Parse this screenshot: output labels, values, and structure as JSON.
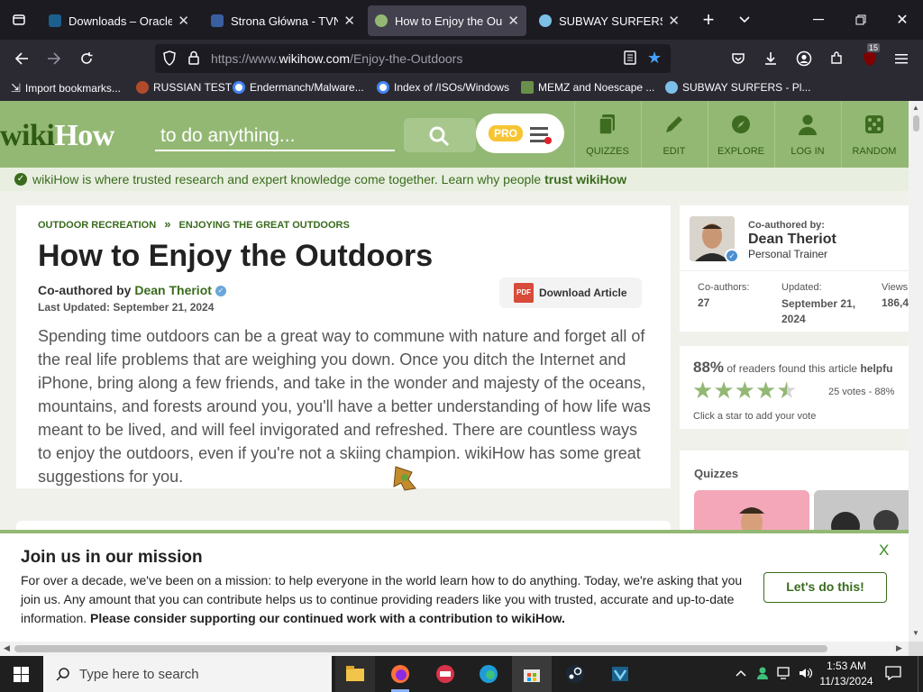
{
  "colors": {
    "brand_green": "#93b874",
    "dark_green": "#3a6b1d",
    "link_green": "#2e7d32"
  },
  "browser": {
    "tabs": [
      {
        "title": "Downloads – Oracle VirtualBox",
        "icon": "virtualbox-icon"
      },
      {
        "title": "Strona Główna - TVN",
        "icon": "tvn-icon"
      },
      {
        "title": "How to Enjoy the Outdoors",
        "icon": "wikihow-icon",
        "active": true
      },
      {
        "title": "SUBWAY SURFERS - Play",
        "icon": "game-icon"
      }
    ],
    "url_prefix": "https://www.",
    "url_domain": "wikihow.com",
    "url_path": "/Enjoy-the-Outdoors",
    "badge": "15",
    "bookmarks": [
      "Import bookmarks...",
      "RUSSIAN TEST",
      "Endermanch/Malware...",
      "Index of /ISOs/Windows",
      "MEMZ and Noescape ...",
      "SUBWAY SURFERS - Pl..."
    ]
  },
  "site": {
    "logo_wiki": "wiki",
    "logo_how": "How",
    "search_placeholder": "to do anything...",
    "pro": "PRO",
    "nav": [
      "QUIZZES",
      "EDIT",
      "EXPLORE",
      "LOG IN",
      "RANDOM"
    ],
    "trust_text": "wikiHow is where trusted research and expert knowledge come together. Learn why people ",
    "trust_link": "trust wikiHow"
  },
  "article": {
    "breadcrumb": [
      "OUTDOOR RECREATION",
      "ENJOYING THE GREAT OUTDOORS"
    ],
    "breadcrumb_sep": "»",
    "title": "How to Enjoy the Outdoors",
    "coauthor_label": "Co-authored by ",
    "coauthor": "Dean Theriot",
    "updated": "Last Updated: September 21, 2024",
    "download": "Download Article",
    "pdf": "PDF",
    "intro": "Spending time outdoors can be a great way to commune with nature and forget all of the real life problems that are weighing you down. Once you ditch the Internet and iPhone, bring along a few friends, and take in the wonder and majesty of the oceans, mountains, and forests around you, you'll have a better understanding of how life was meant to be lived, and will feel invigorated and refreshed. There are countless ways to enjoy the outdoors, even if you're not a skiing champion. wikiHow has some great suggestions for you."
  },
  "sidebar": {
    "coauthored_label": "Co-authored by:",
    "name": "Dean Theriot",
    "role": "Personal Trainer",
    "stats": [
      {
        "label": "Co-authors:",
        "value": "27"
      },
      {
        "label": "Updated:",
        "value": "September 21, 2024"
      },
      {
        "label": "Views",
        "value": "186,4"
      }
    ],
    "helpful_percent": "88%",
    "helpful_text": " of readers found this article ",
    "helpful_bold": "helpfu",
    "rating": 4.5,
    "votes": "25 votes - 88%",
    "rate_hint": "Click a star to add your vote",
    "quizzes_title": "Quizzes"
  },
  "banner": {
    "title": "Join us in our mission",
    "close": "X",
    "body": "For over a decade, we've been on a mission: to help everyone in the world learn how to do anything. Today, we're asking that you join us. Any amount that you can contribute helps us to continue providing readers like you with trusted, accurate and up-to-date information. ",
    "body_bold": "Please consider supporting our continued work with a contribution to wikiHow.",
    "button": "Let's do this!"
  },
  "taskbar": {
    "search_placeholder": "Type here to search",
    "time": "1:53 AM",
    "date": "11/13/2024",
    "apps": [
      "file-explorer-icon",
      "firefox-icon",
      "game-icon",
      "edge-icon",
      "store-icon",
      "steam-icon",
      "virtualbox-icon"
    ]
  }
}
